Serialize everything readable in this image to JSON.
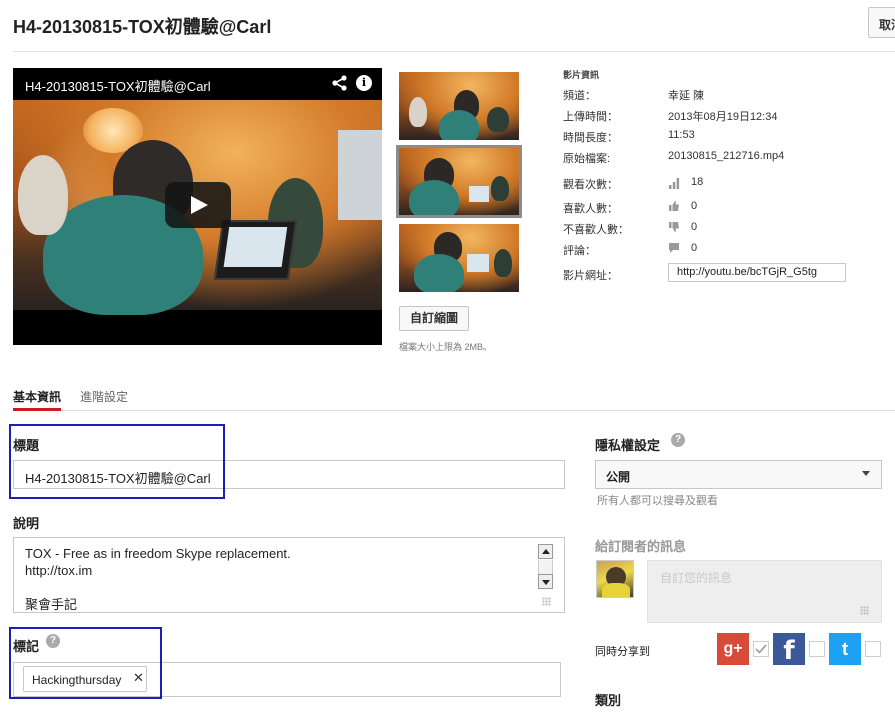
{
  "header": {
    "title": "H4-20130815-TOX初體驗@Carl",
    "cancel_label": "取消"
  },
  "player": {
    "title": "H4-20130815-TOX初體驗@Carl",
    "share_icon": "share-icon",
    "info_icon": "info-icon",
    "info_glyph": "i",
    "play_icon": "play-icon"
  },
  "thumbnails": {
    "custom_button": "自訂縮圖",
    "size_note": "檔案大小上限為 2MB。"
  },
  "video_info": {
    "heading": "影片資訊",
    "rows": [
      {
        "label": "頻道：",
        "value": "幸延 陳"
      },
      {
        "label": "上傳時間：",
        "value": "2013年08月19日12:34"
      },
      {
        "label": "時間長度：",
        "value": "11:53"
      },
      {
        "label": "原始檔案:",
        "value": "20130815_212716.mp4"
      }
    ],
    "stats": [
      {
        "label": "觀看次數：",
        "icon": "bar-chart-icon",
        "value": "18"
      },
      {
        "label": "喜歡人數：",
        "icon": "thumbs-up-icon",
        "value": "0"
      },
      {
        "label": "不喜歡人數：",
        "icon": "thumbs-down-icon",
        "value": "0"
      },
      {
        "label": "評論：",
        "icon": "comment-icon",
        "value": "0"
      }
    ],
    "url_label": "影片網址：",
    "url_value": "http://youtu.be/bcTGjR_G5tg"
  },
  "tabs": [
    {
      "label": "基本資訊",
      "active": true
    },
    {
      "label": "進階設定",
      "active": false
    }
  ],
  "form": {
    "title_label": "標題",
    "title_value": "H4-20130815-TOX初體驗@Carl",
    "description_label": "說明",
    "description_lines": [
      "TOX - Free as in freedom Skype replacement.",
      "http://tox.im",
      "",
      "聚會手記"
    ],
    "tags_label": "標記",
    "tags_help": "?",
    "tags": [
      "Hackingthursday"
    ],
    "tag_remove_glyph": "✕"
  },
  "privacy": {
    "label": "隱私權設定",
    "help": "?",
    "selected": "公開",
    "hint": "所有人都可以搜尋及觀看"
  },
  "subscribers": {
    "label": "給訂閱者的訊息",
    "placeholder": "自訂您的訊息"
  },
  "share": {
    "label": "同時分享到",
    "networks": [
      {
        "name": "Google+",
        "glyph": "g+",
        "color": "#d84b38",
        "checked": true
      },
      {
        "name": "Facebook",
        "glyph": "f",
        "color": "#3b5998",
        "checked": false
      },
      {
        "name": "Twitter",
        "glyph": "t",
        "color": "#1da1f2",
        "checked": false
      }
    ]
  },
  "category": {
    "label": "類別"
  },
  "colors": {
    "accent_tab": "#cc181e",
    "highlight_box": "#1d1db8"
  }
}
